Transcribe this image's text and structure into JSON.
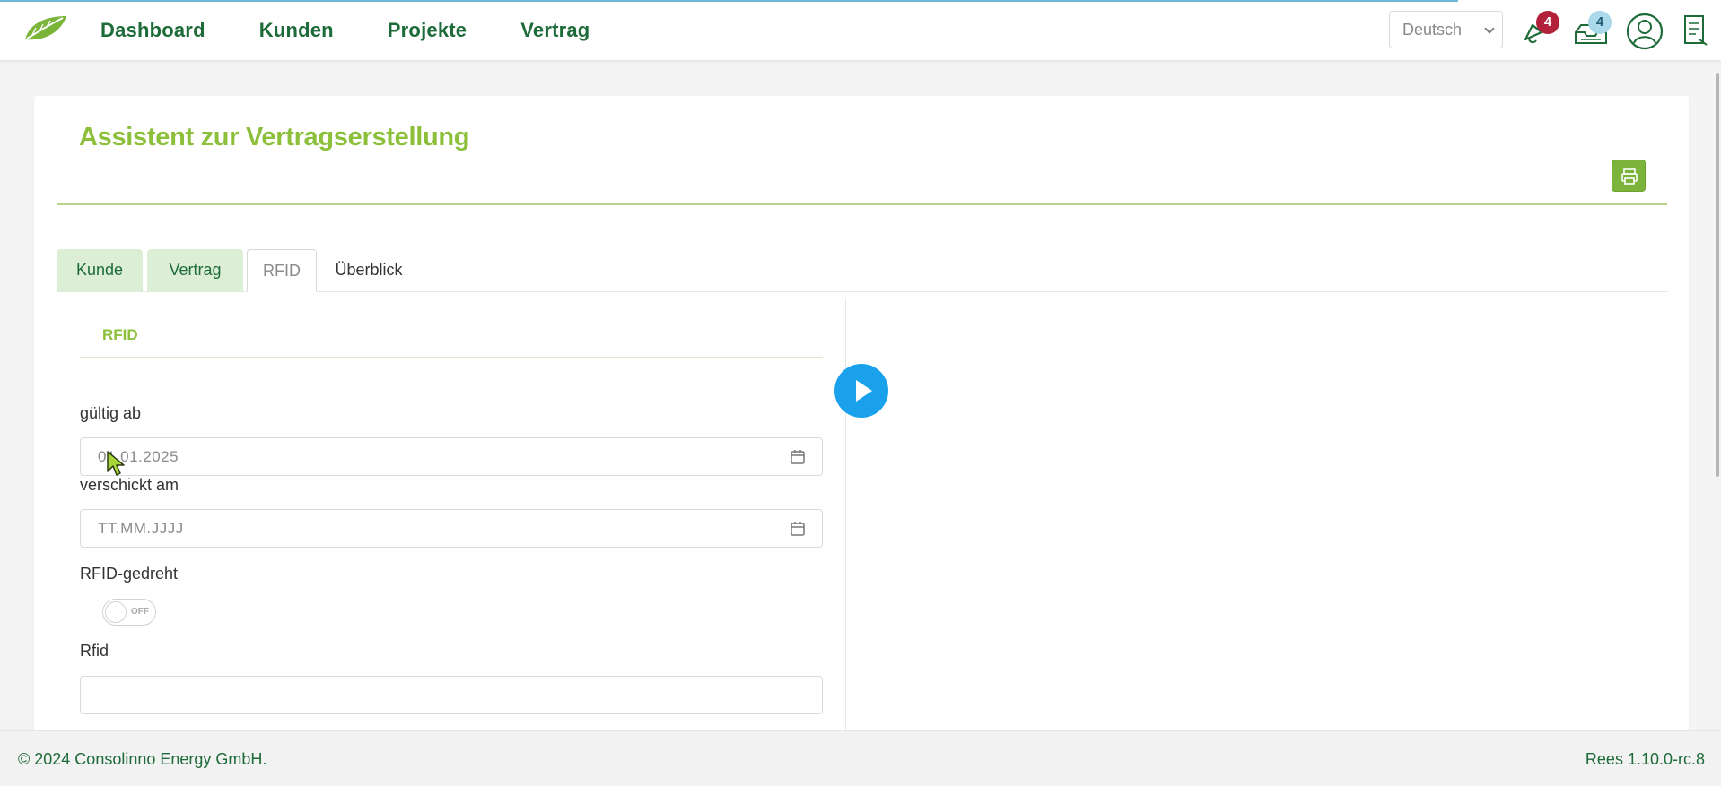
{
  "header": {
    "nav": [
      "Dashboard",
      "Kunden",
      "Projekte",
      "Vertrag"
    ],
    "language": "Deutsch",
    "notifications_count": "4",
    "tasks_count": "4"
  },
  "page": {
    "title": "Assistent zur Vertragserstellung",
    "tabs": [
      {
        "label": "Kunde",
        "state": "done"
      },
      {
        "label": "Vertrag",
        "state": "done"
      },
      {
        "label": "RFID",
        "state": "active"
      },
      {
        "label": "Überblick",
        "state": "plain"
      }
    ],
    "section_title": "RFID",
    "fields": {
      "valid_from_label": "gültig ab",
      "valid_from_value": "01.01.2025",
      "sent_on_label": "verschickt am",
      "sent_on_placeholder": "TT.MM.JJJJ",
      "rfid_turned_label": "RFID-gedreht",
      "rfid_turned_state": "OFF",
      "rfid_label": "Rfid",
      "rfid_value": ""
    }
  },
  "footer": {
    "copyright": "© 2024 Consolinno Energy GmbH.",
    "version": "Rees 1.10.0-rc.8"
  },
  "colors": {
    "brand_green": "#1e6b3a",
    "accent_green": "#8cbf3a",
    "tab_done_bg": "#dcefd6",
    "badge_red": "#b2203a",
    "badge_blue": "#a9d9ea",
    "play_blue": "#19a1ec"
  }
}
